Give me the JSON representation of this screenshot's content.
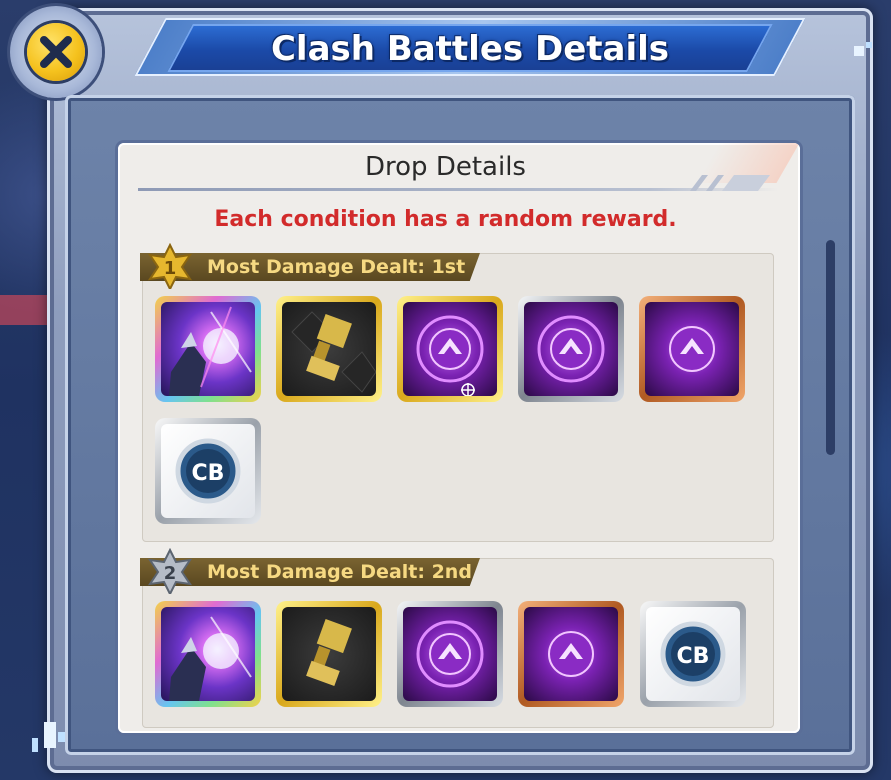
{
  "dialog": {
    "title": "Clash Battles Details",
    "close_label": "close"
  },
  "content": {
    "section_title": "Drop Details",
    "subtitle": "Each condition has a random reward."
  },
  "groups": [
    {
      "rank": "1",
      "label": "Most Damage Dealt: 1st",
      "items": [
        {
          "name": "digimon-reward",
          "frame": "rainbow",
          "icon": "digimon-portrait-icon"
        },
        {
          "name": "chip-reward",
          "frame": "gold",
          "icon": "plug-chip-icon"
        },
        {
          "name": "purple-emblem-reward",
          "frame": "gold",
          "icon": "purple-emblem-icon"
        },
        {
          "name": "purple-emblem-reward",
          "frame": "silver",
          "icon": "purple-emblem-icon"
        },
        {
          "name": "purple-emblem-reward",
          "frame": "bronze",
          "icon": "purple-emblem-icon"
        },
        {
          "name": "cb-medal-reward",
          "frame": "white",
          "icon": "cb-medal-icon",
          "badge": "CB"
        }
      ]
    },
    {
      "rank": "2",
      "label": "Most Damage Dealt: 2nd",
      "items": [
        {
          "name": "digimon-reward",
          "frame": "rainbow",
          "icon": "digimon-portrait-icon"
        },
        {
          "name": "chip-reward",
          "frame": "gold",
          "icon": "plug-chip-icon"
        },
        {
          "name": "purple-emblem-reward",
          "frame": "silver",
          "icon": "purple-emblem-icon"
        },
        {
          "name": "purple-emblem-reward",
          "frame": "bronze",
          "icon": "purple-emblem-icon"
        },
        {
          "name": "cb-medal-reward",
          "frame": "white",
          "icon": "cb-medal-icon",
          "badge": "CB"
        }
      ]
    }
  ],
  "colors": {
    "subtitle": "#d22b2b",
    "label_text": "#f6d982",
    "label_bg": "#6a5528",
    "banner": "#1b4aa8",
    "close_button": "#f5c21e"
  }
}
